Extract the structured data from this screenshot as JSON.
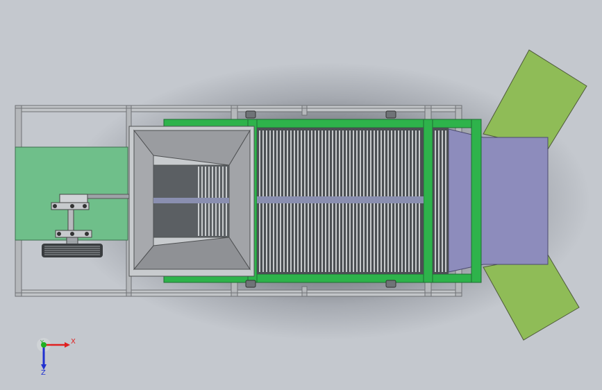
{
  "triad": {
    "x_label": "X",
    "y_label": "Y",
    "z_label": "Z",
    "x_color": "#e02020",
    "y_color": "#20b020",
    "z_color": "#2030d0"
  },
  "colors": {
    "motor_plate": "#6fbf8a",
    "conveyor_green": "#2eb34b",
    "chute_green": "#8fbc57",
    "chute_purple": "#8d8cbc",
    "frame_grey": "#b9bcbf",
    "hopper_grey": "#9a9ca0"
  }
}
